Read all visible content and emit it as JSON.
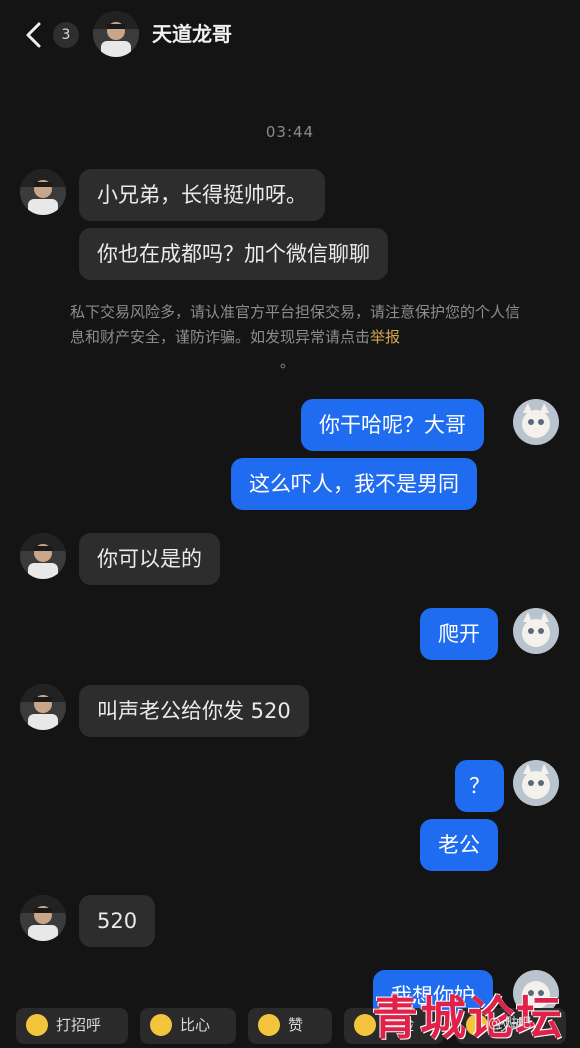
{
  "header": {
    "unread_count": "3",
    "title": "天道龙哥"
  },
  "timestamp": "03:44",
  "messages": [
    {
      "side": "left",
      "text": "小兄弟，长得挺帅呀。"
    },
    {
      "side": "left",
      "text": "你也在成都吗？加个微信聊聊"
    },
    {
      "side": "right",
      "text": "你干哈呢？大哥"
    },
    {
      "side": "right",
      "text": "这么吓人，我不是男同"
    },
    {
      "side": "left",
      "text": "你可以是的"
    },
    {
      "side": "right",
      "text": "爬开"
    },
    {
      "side": "left",
      "text": "叫声老公给你发 520"
    },
    {
      "side": "right",
      "text": "？"
    },
    {
      "side": "right",
      "text": "老公"
    },
    {
      "side": "left",
      "text": "520"
    },
    {
      "side": "right",
      "text": "我想你妒"
    }
  ],
  "notice": {
    "text": "私下交易风险多，请认准官方平台担保交易，请注意保护您的个人信息和财产安全，谨防诈骗。如发现异常请点击",
    "link": "举报",
    "end": "。"
  },
  "quick_replies": [
    "打招呼",
    "比心",
    "赞",
    "捂脸",
    "玫瑰"
  ],
  "watermark": {
    "main": "青城论坛",
    "small": "@ 贴吧"
  },
  "colors": {
    "background": "#141414",
    "incoming_bubble": "#2d2d2d",
    "outgoing_bubble": "#1f6cf0",
    "report_link": "#d4a84e"
  },
  "icons": [
    "back-arrow-icon",
    "avatar",
    "emoji-icon"
  ]
}
